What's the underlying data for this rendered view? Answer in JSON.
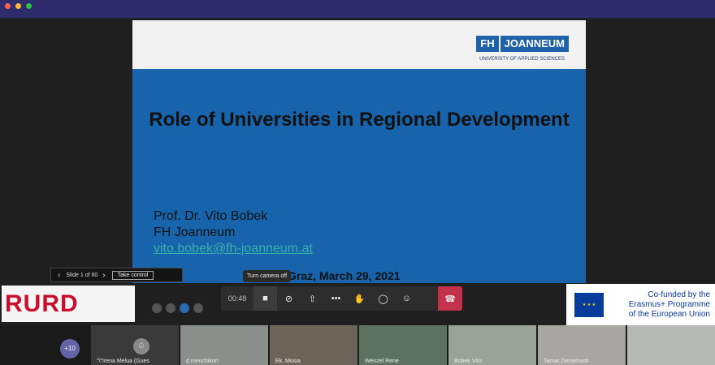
{
  "colors": {
    "titlebar": "#2f2c6e",
    "slide_bg": "#1764ad",
    "hangup": "#c4314b",
    "eu_blue": "#073b9c"
  },
  "slide": {
    "logo_fh": "FH",
    "logo_joanneum": "JOANNEUM",
    "logo_sub": "UNIVERSITY OF APPLIED SCIENCES",
    "title": "Role of Universities in Regional Development",
    "author_lines": [
      "Prof. Dr. Vito Bobek",
      "FH Joanneum"
    ],
    "email": "vito.bobek@fh-joanneum.at",
    "date": "Graz, March 29, 2021"
  },
  "slide_nav": {
    "prev_icon": "chevron-left-icon",
    "label": "Slide 1 of 60",
    "next_icon": "chevron-right-icon",
    "take_control": "Take control"
  },
  "tooltip": "Turn camera off",
  "toolbar": {
    "timer": "00:48",
    "buttons": [
      {
        "name": "camera-button",
        "icon": "camera-icon"
      },
      {
        "name": "mute-button",
        "icon": "mic-off-icon"
      },
      {
        "name": "share-button",
        "icon": "share-icon"
      },
      {
        "name": "more-button",
        "icon": "ellipsis-icon"
      },
      {
        "name": "raise-hand-button",
        "icon": "hand-icon"
      },
      {
        "name": "chat-button",
        "icon": "chat-icon"
      },
      {
        "name": "participants-button",
        "icon": "people-icon"
      },
      {
        "name": "hang-up-button",
        "icon": "phone-icon"
      }
    ]
  },
  "rurd_logo": "RURD",
  "eu": {
    "lines": [
      "Co-funded by the",
      "Erasmus+ Programme",
      "of the European Union"
    ]
  },
  "gallery": {
    "more_count": "+10",
    "participants": [
      "\"\\\"Irena Melua (Gues",
      "d.menchikori",
      "Ek. Mosia",
      "Wenzel Rene",
      "Bobek Vito",
      "Tamar Demetrash",
      ""
    ]
  }
}
